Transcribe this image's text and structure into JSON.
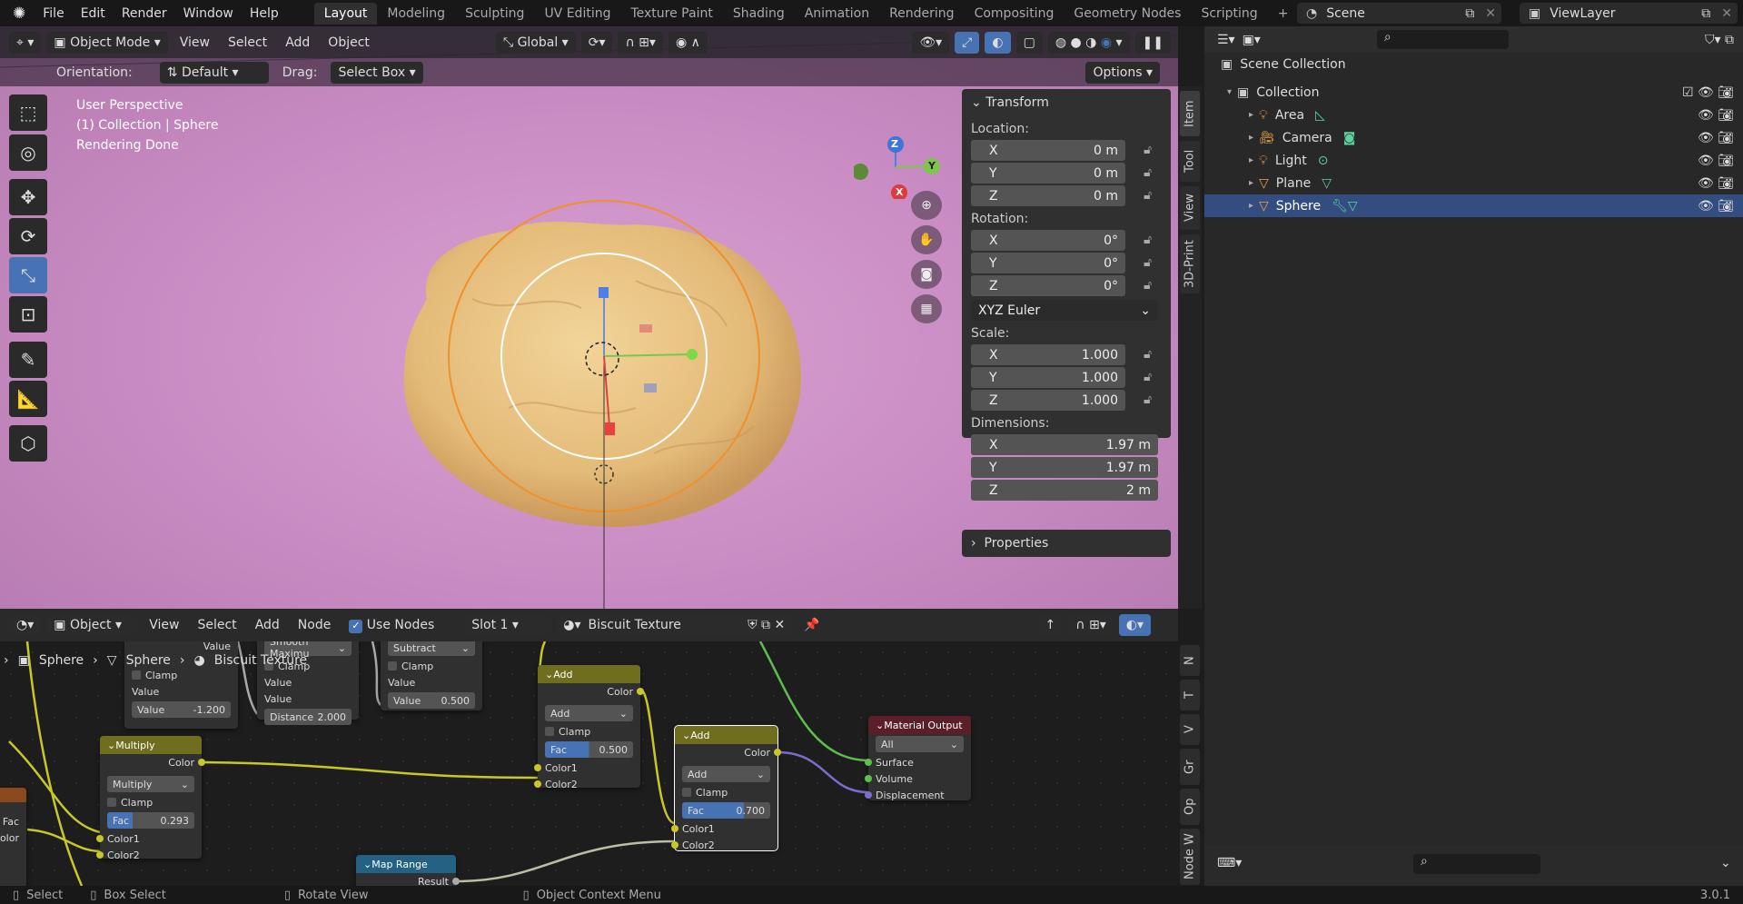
{
  "topbar": {
    "menus": [
      "File",
      "Edit",
      "Render",
      "Window",
      "Help"
    ],
    "workspaces": [
      "Layout",
      "Modeling",
      "Sculpting",
      "UV Editing",
      "Texture Paint",
      "Shading",
      "Animation",
      "Rendering",
      "Compositing",
      "Geometry Nodes",
      "Scripting"
    ],
    "active_workspace": "Layout",
    "scene": "Scene",
    "view_layer": "ViewLayer"
  },
  "viewport_header": {
    "mode": "Object Mode",
    "menus": [
      "View",
      "Select",
      "Add",
      "Object"
    ],
    "transform_orientation": "Global"
  },
  "tool_settings": {
    "orientation_label": "Orientation:",
    "orientation": "Default",
    "drag_label": "Drag:",
    "drag": "Select Box",
    "options": "Options"
  },
  "viewport_info": [
    "User Perspective",
    "(1) Collection | Sphere",
    "Rendering Done"
  ],
  "gizmo": {
    "x": "X",
    "y": "Y",
    "z": "Z"
  },
  "npanel": {
    "transform_title": "Transform",
    "location_label": "Location:",
    "location": [
      {
        "axis": "X",
        "value": "0 m"
      },
      {
        "axis": "Y",
        "value": "0 m"
      },
      {
        "axis": "Z",
        "value": "0 m"
      }
    ],
    "rotation_label": "Rotation:",
    "rotation": [
      {
        "axis": "X",
        "value": "0°"
      },
      {
        "axis": "Y",
        "value": "0°"
      },
      {
        "axis": "Z",
        "value": "0°"
      }
    ],
    "rotation_mode": "XYZ Euler",
    "scale_label": "Scale:",
    "scale": [
      {
        "axis": "X",
        "value": "1.000"
      },
      {
        "axis": "Y",
        "value": "1.000"
      },
      {
        "axis": "Z",
        "value": "1.000"
      }
    ],
    "dimensions_label": "Dimensions:",
    "dimensions": [
      {
        "axis": "X",
        "value": "1.97 m"
      },
      {
        "axis": "Y",
        "value": "1.97 m"
      },
      {
        "axis": "Z",
        "value": "2 m"
      }
    ],
    "properties_title": "Properties"
  },
  "side_tabs": [
    "Item",
    "Tool",
    "View",
    "3D-Print"
  ],
  "outliner": {
    "rows": [
      {
        "label": "Scene Collection"
      },
      {
        "label": "Collection"
      },
      {
        "label": "Area"
      },
      {
        "label": "Camera"
      },
      {
        "label": "Light"
      },
      {
        "label": "Plane"
      },
      {
        "label": "Sphere",
        "selected": true
      }
    ]
  },
  "node_header": {
    "type": "Object",
    "menus": [
      "View",
      "Select",
      "Add",
      "Node"
    ],
    "use_nodes": "Use Nodes",
    "slot": "Slot 1",
    "material": "Biscuit Texture"
  },
  "breadcrumb": [
    "Sphere",
    "Sphere",
    "Biscuit Texture"
  ],
  "node_side_tabs": [
    "N",
    "T",
    "V",
    "Gr",
    "Op",
    "Node W"
  ],
  "nodes": {
    "n1": {
      "rows": [
        "Value",
        "Clamp",
        "Value"
      ],
      "field": "Value",
      "field_val": "-1.200"
    },
    "n2": {
      "op": "Smooth Maximu",
      "rows": [
        "Clamp",
        "Value",
        "Value"
      ],
      "field": "Distance",
      "field_val": "2.000"
    },
    "n3": {
      "op": "Subtract",
      "rows": [
        "Clamp",
        "Value"
      ],
      "field": "Value",
      "field_val": "0.500"
    },
    "multiply": {
      "title": "Multiply",
      "out": "Color",
      "op": "Multiply",
      "clamp": "Clamp",
      "fac": "Fac",
      "fac_val": "0.293",
      "in1": "Color1",
      "in2": "Color2"
    },
    "add1": {
      "title": "Add",
      "out": "Color",
      "op": "Add",
      "clamp": "Clamp",
      "fac": "Fac",
      "fac_val": "0.500",
      "in1": "Color1",
      "in2": "Color2"
    },
    "add2": {
      "title": "Add",
      "out": "Color",
      "op": "Add",
      "clamp": "Clamp",
      "fac": "Fac",
      "fac_val": "0.700",
      "in1": "Color1",
      "in2": "Color2"
    },
    "output": {
      "title": "Material Output",
      "target": "All",
      "in": [
        "Surface",
        "Volume",
        "Displacement"
      ]
    },
    "maprange": {
      "title": "Map Range",
      "out": "Result"
    },
    "left": {
      "fac": "Fac",
      "color": "olor"
    }
  },
  "status": {
    "select": "Select",
    "box_select": "Box Select",
    "rotate": "Rotate View",
    "context": "Object Context Menu",
    "version": "3.0.1"
  },
  "colors": {
    "accent": "#4772b3",
    "selection": "#334d80",
    "viewport_bg": "#c88ac2",
    "biscuit": "#e8c27f",
    "mix_header": "#6e6e1e",
    "output_header": "#5c1f2a",
    "converter_header": "#246283"
  }
}
